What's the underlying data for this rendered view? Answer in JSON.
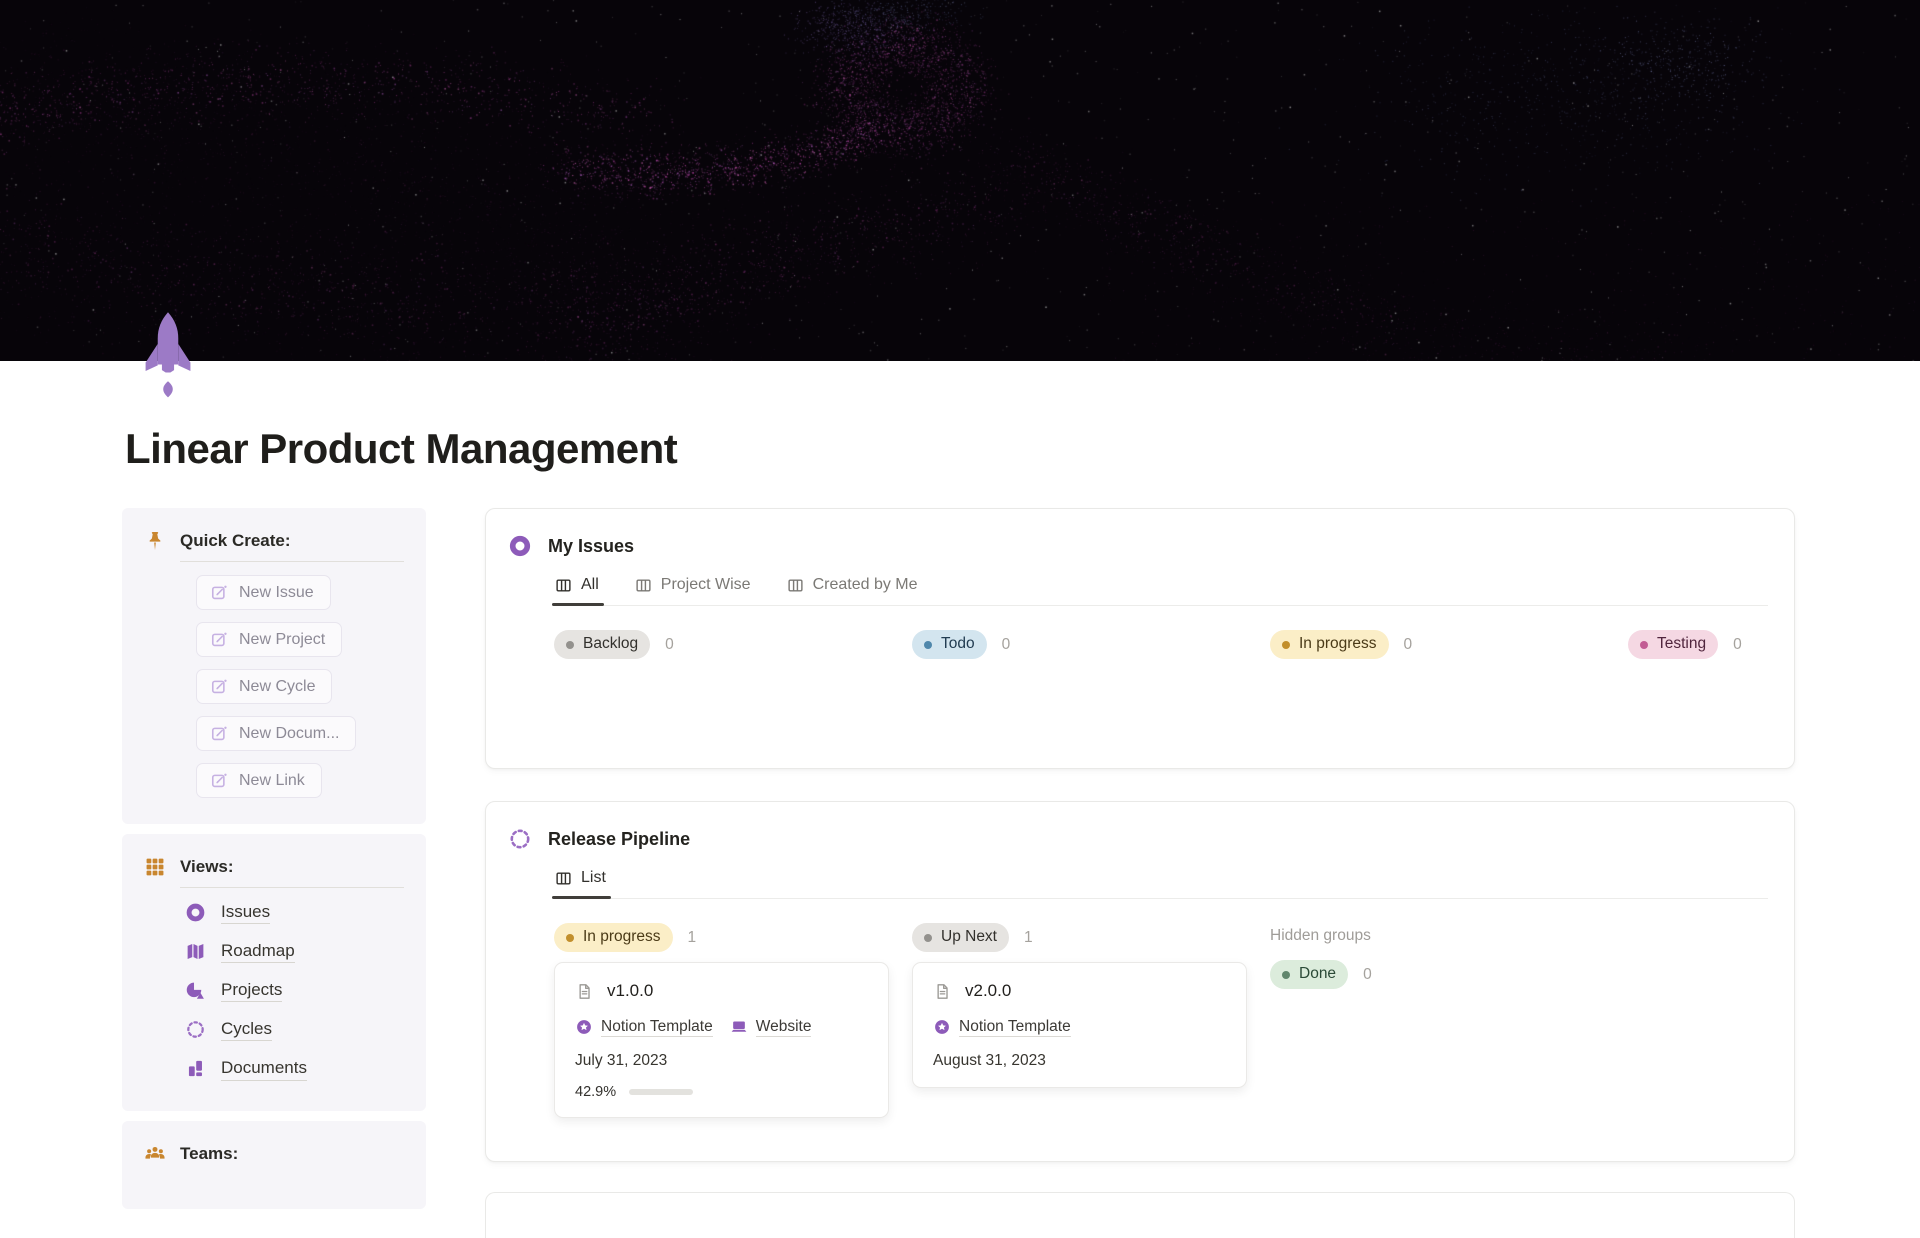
{
  "page": {
    "title": "Linear Product Management"
  },
  "sidebar": {
    "quick_create": {
      "title": "Quick Create:",
      "items": [
        "New Issue",
        "New Project",
        "New Cycle",
        "New Docum...",
        "New Link"
      ]
    },
    "views": {
      "title": "Views:",
      "items": [
        {
          "label": "Issues",
          "icon": "donut-circle-icon"
        },
        {
          "label": "Roadmap",
          "icon": "map-icon"
        },
        {
          "label": "Projects",
          "icon": "shapes-icon"
        },
        {
          "label": "Cycles",
          "icon": "dashed-circle-icon"
        },
        {
          "label": "Documents",
          "icon": "blocks-icon"
        }
      ]
    },
    "teams": {
      "title": "Teams:",
      "icon": "people-icon"
    }
  },
  "my_issues": {
    "icon": "donut-circle-icon",
    "title": "My Issues",
    "tabs": [
      {
        "label": "All",
        "active": true
      },
      {
        "label": "Project Wise",
        "active": false
      },
      {
        "label": "Created by Me",
        "active": false
      }
    ],
    "groups": [
      {
        "label": "Backlog",
        "count": "0",
        "color": "gray"
      },
      {
        "label": "Todo",
        "count": "0",
        "color": "blue"
      },
      {
        "label": "In progress",
        "count": "0",
        "color": "yellow"
      },
      {
        "label": "Testing",
        "count": "0",
        "color": "pink"
      }
    ]
  },
  "release_pipeline": {
    "icon": "dashed-circle-icon",
    "title": "Release Pipeline",
    "tabs": [
      {
        "label": "List",
        "active": true
      }
    ],
    "groups": [
      {
        "label": "In progress",
        "count": "1",
        "color": "yellow"
      },
      {
        "label": "Up Next",
        "count": "1",
        "color": "gray"
      }
    ],
    "hidden_groups_label": "Hidden groups",
    "hidden_groups": [
      {
        "label": "Done",
        "count": "0",
        "color": "green"
      }
    ],
    "cards": [
      {
        "title": "v1.0.0",
        "links": [
          {
            "label": "Notion Template",
            "icon": "star-badge-icon"
          },
          {
            "label": "Website",
            "icon": "laptop-icon"
          }
        ],
        "date": "July 31, 2023",
        "progress_label": "42.9%",
        "progress_pct": 42.9
      },
      {
        "title": "v2.0.0",
        "links": [
          {
            "label": "Notion Template",
            "icon": "star-badge-icon"
          }
        ],
        "date": "August 31, 2023"
      }
    ]
  },
  "colors": {
    "accent_purple": "#8d5bb9",
    "rocket_purple": "#9c7ac6",
    "icon_orange": "#c9862f",
    "pill_gray_bg": "#e6e4e1",
    "pill_blue_bg": "#d3e5ef",
    "pill_yellow_bg": "#fbeec7",
    "pill_pink_bg": "#f5d8e3",
    "pill_green_bg": "#dcecdc",
    "progress_green": "#5b8a6d",
    "banner_bg": "#070409"
  }
}
